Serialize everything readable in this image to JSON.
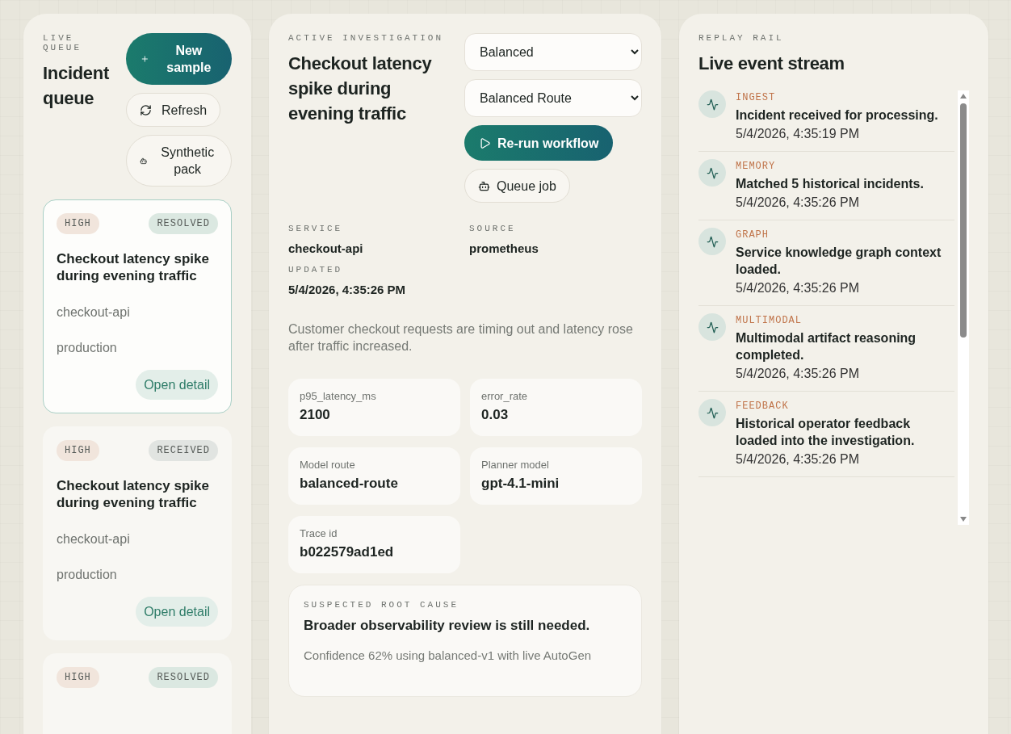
{
  "queue": {
    "eyebrow": "LIVE QUEUE",
    "title": "Incident queue",
    "new_sample": "New sample",
    "refresh": "Refresh",
    "synthetic": "Synthetic pack",
    "incidents": [
      {
        "severity": "HIGH",
        "status": {
          "label": "RESOLVED",
          "color": "#dbe8e1"
        },
        "title": "Checkout latency spike during evening traffic",
        "service": "checkout-api",
        "environment": "production",
        "action": "Open detail",
        "selected": true
      },
      {
        "severity": "HIGH",
        "status": {
          "label": "RECEIVED",
          "color": "#e1e4e1"
        },
        "title": "Checkout latency spike during evening traffic",
        "service": "checkout-api",
        "environment": "production",
        "action": "Open detail",
        "selected": false
      },
      {
        "severity": "HIGH",
        "status": {
          "label": "RESOLVED",
          "color": "#dbe8e1"
        },
        "selected": false
      }
    ]
  },
  "investigation": {
    "eyebrow": "ACTIVE INVESTIGATION",
    "title": "Checkout latency spike during evening traffic",
    "mode_select": "Balanced",
    "route_select": "Balanced Route",
    "run_button": "Re-run workflow",
    "queue_button": "Queue job",
    "meta": [
      {
        "label": "SERVICE",
        "value": "checkout-api"
      },
      {
        "label": "SOURCE",
        "value": "prometheus"
      },
      {
        "label": "UPDATED",
        "value": "5/4/2026, 4:35:26 PM"
      }
    ],
    "description": "Customer checkout requests are timing out and latency rose after traffic increased.",
    "metrics": [
      {
        "label": "p95_latency_ms",
        "value": "2100"
      },
      {
        "label": "error_rate",
        "value": "0.03"
      },
      {
        "label": "Model route",
        "value": "balanced-route"
      },
      {
        "label": "Planner model",
        "value": "gpt-4.1-mini"
      },
      {
        "label": "Trace id",
        "value": "b022579ad1ed"
      }
    ],
    "root_cause": {
      "eyebrow": "SUSPECTED ROOT CAUSE",
      "title": "Broader observability review is still needed.",
      "detail": "Confidence 62% using balanced-v1 with live AutoGen"
    }
  },
  "replay": {
    "eyebrow": "REPLAY RAIL",
    "title": "Live event stream",
    "events": [
      {
        "stage": "INGEST",
        "message": "Incident received for processing.",
        "time": "5/4/2026, 4:35:19 PM"
      },
      {
        "stage": "MEMORY",
        "message": "Matched 5 historical incidents.",
        "time": "5/4/2026, 4:35:26 PM"
      },
      {
        "stage": "GRAPH",
        "message": "Service knowledge graph context loaded.",
        "time": "5/4/2026, 4:35:26 PM"
      },
      {
        "stage": "MULTIMODAL",
        "message": "Multimodal artifact reasoning completed.",
        "time": "5/4/2026, 4:35:26 PM"
      },
      {
        "stage": "FEEDBACK",
        "message": "Historical operator feedback loaded into the investigation.",
        "time": "5/4/2026, 4:35:26 PM"
      }
    ]
  }
}
